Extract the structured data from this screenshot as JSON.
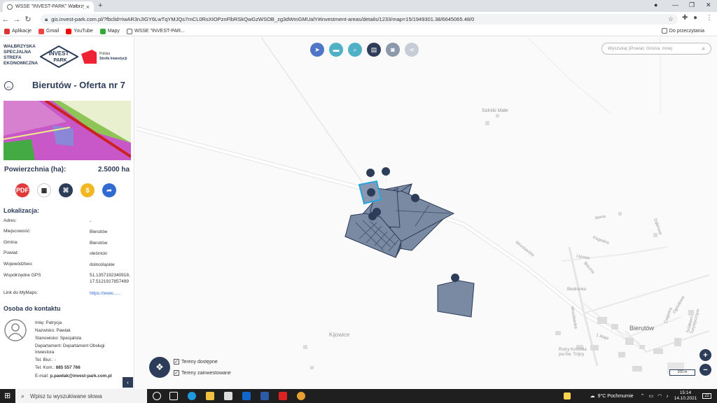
{
  "browser": {
    "tab_title": "WSSE \"INVEST-PARK\" Wałbrzysk...",
    "url": "gis.invest-park.com.pl/?fbclid=IwAR3nJIGY6LwTqYMJQs7rnCL0RsXIOPznFlbRSkQwGzWSOB_zg3dWmGMUalY#investment-areas/details/1233/map=15/1949301.38/6645065.48/0",
    "bookmarks": [
      "Aplikacje",
      "Gmail",
      "YouTube",
      "Mapy",
      "WSSE \"INVEST-PAR..."
    ],
    "reading_list": "Do przeczytania"
  },
  "sidebar": {
    "brand_lines": [
      "WAŁBRZYSKA",
      "SPECJALNA",
      "STREFA",
      "EKONOMICZNA"
    ],
    "logo_invest": "INVEST",
    "logo_park": "PARK",
    "ps_line1": "Polska",
    "ps_line2": "Strefa Inwestycji",
    "offer_title": "Bierutów - Oferta nr 7",
    "area_label": "Powierzchnia (ha):",
    "area_value": "2.5000 ha",
    "action_icons": [
      "pdf-icon",
      "qr-code-icon",
      "area-icon",
      "dollar-icon",
      "share-arrow-icon"
    ],
    "location_heading": "Lokalizacja:",
    "location": [
      {
        "label": "Adres:",
        "value": "-"
      },
      {
        "label": "Miejscowość:",
        "value": "Bierutów"
      },
      {
        "label": "Gmina:",
        "value": "Bierutów"
      },
      {
        "label": "Powiat:",
        "value": "oleśnicki"
      },
      {
        "label": "Województwo:",
        "value": "dolnośląskie"
      },
      {
        "label": "Współrzędne GPS",
        "value": "51.1357192340918,",
        "value2": "17.5121917857499"
      },
      {
        "label": "Link do MyMaps:",
        "value": "https://www......"
      }
    ],
    "contact_heading": "Osoba do kontaktu",
    "contact": {
      "first_name": "Imię: Patrycja",
      "last_name": "Nazwisko: Pawlak",
      "position": "Stanowisko: Specjalista",
      "department": "Departament: Departament Obsługi",
      "department2": "Inwestora",
      "office_phone": "Tel. Biur.: -",
      "mobile_label": "Tel. Kom.: ",
      "mobile": "885 557 766",
      "email_label": "E-mail: ",
      "email": "p.pawlak@invest-park.com.pl"
    }
  },
  "map": {
    "search_placeholder": "Wyszukaj (Powiat, Gmina, Inne)",
    "toolbar_icons": [
      "cursor-icon",
      "ruler-icon",
      "zoom-icon",
      "print-icon",
      "camera-icon",
      "share-icon"
    ],
    "legend": [
      "Tereny dostępne",
      "Tereny zainwestowane"
    ],
    "scale": "200 m",
    "places": [
      "Solniki Małe",
      "Kijowice",
      "Bierutów",
      "Biedronka",
      "Ruiny Kościoła pw.Św. Trójcy"
    ],
    "streets": [
      "Wrocławska",
      "Pogodna",
      "Jasna",
      "Dąbrowa",
      "Ogrodowa",
      "Boczna",
      "Lipowa",
      "Wrocławska",
      "Cegielna",
      "1 Maja",
      "Szlakiem Turystycznym"
    ]
  },
  "taskbar": {
    "search_placeholder": "Wpisz tu wyszukiwane słowa",
    "weather": "9°C  Pochmurnie",
    "time": "15:14",
    "date": "14.10.2021",
    "notifications": "22"
  },
  "colors": {
    "navy": "#2d3c58",
    "parcel_fill": "#7a8aa3",
    "selected_parcel": "#26a6e0",
    "tool_teal": "#4fb0c6"
  }
}
